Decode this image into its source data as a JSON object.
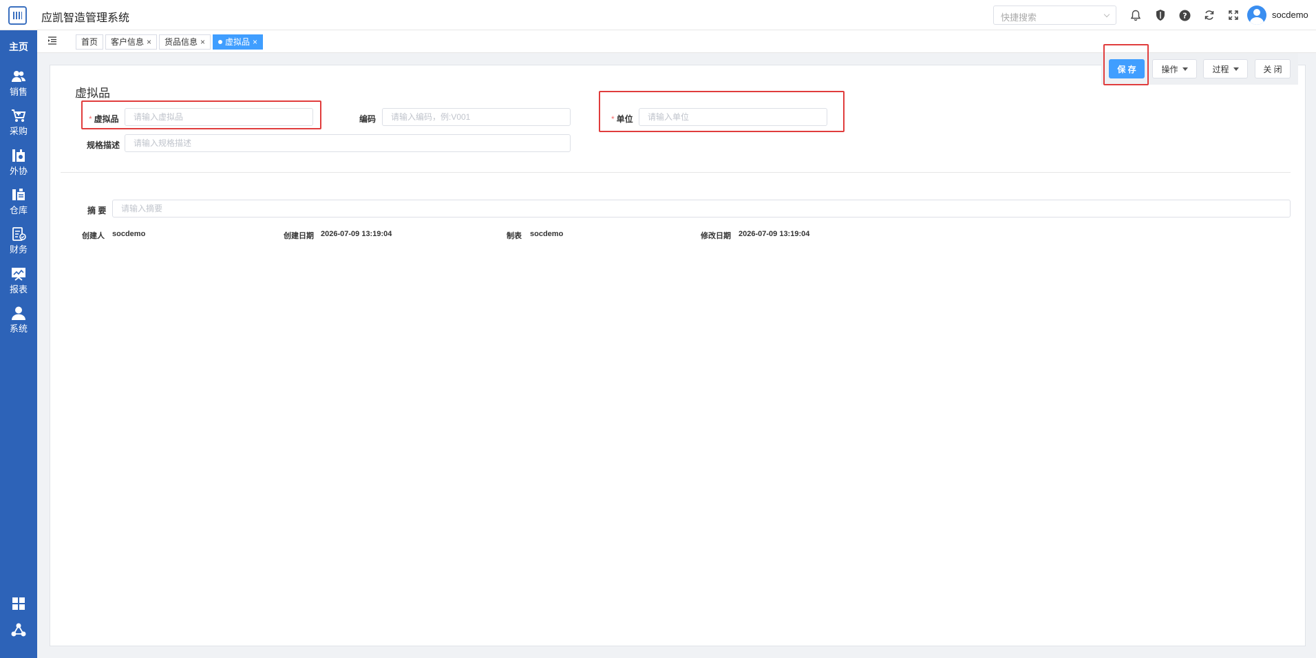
{
  "app": {
    "title": "应凯智造管理系统"
  },
  "header": {
    "search_placeholder": "快捷搜索",
    "username": "socdemo",
    "icons": [
      "bell-icon",
      "shield-icon",
      "help-icon",
      "refresh-icon",
      "fullscreen-icon"
    ]
  },
  "sidebar": {
    "home": "主页",
    "items": [
      {
        "label": "销售",
        "icon": "users-icon"
      },
      {
        "label": "采购",
        "icon": "cart-icon"
      },
      {
        "label": "外协",
        "icon": "outsource-icon"
      },
      {
        "label": "仓库",
        "icon": "warehouse-icon"
      },
      {
        "label": "财务",
        "icon": "finance-icon"
      },
      {
        "label": "报表",
        "icon": "report-icon"
      },
      {
        "label": "系统",
        "icon": "user-icon"
      }
    ]
  },
  "tabs": [
    {
      "label": "首页",
      "closable": false,
      "active": false
    },
    {
      "label": "客户信息",
      "closable": true,
      "active": false
    },
    {
      "label": "货品信息",
      "closable": true,
      "active": false
    },
    {
      "label": "虚拟品",
      "closable": true,
      "active": true
    }
  ],
  "toolbar": {
    "save": "保 存",
    "operate": "操作",
    "process": "过程",
    "close": "关 闭"
  },
  "form": {
    "title": "虚拟品",
    "virtual_item": {
      "label": "虚拟品",
      "placeholder": "请输入虚拟品",
      "value": ""
    },
    "code": {
      "label": "编码",
      "placeholder": "请输入编码，例:V001",
      "value": ""
    },
    "unit": {
      "label": "单位",
      "placeholder": "请输入单位",
      "value": ""
    },
    "spec": {
      "label": "规格描述",
      "placeholder": "请输入规格描述",
      "value": ""
    },
    "summary": {
      "label": "摘 要",
      "placeholder": "请输入摘要",
      "value": ""
    }
  },
  "meta": {
    "creator_label": "创建人",
    "creator": "socdemo",
    "created_label": "创建日期",
    "created": "2026-07-09 13:19:04",
    "maker_label": "制表",
    "maker": "socdemo",
    "modified_label": "修改日期",
    "modified": "2026-07-09 13:19:04"
  }
}
